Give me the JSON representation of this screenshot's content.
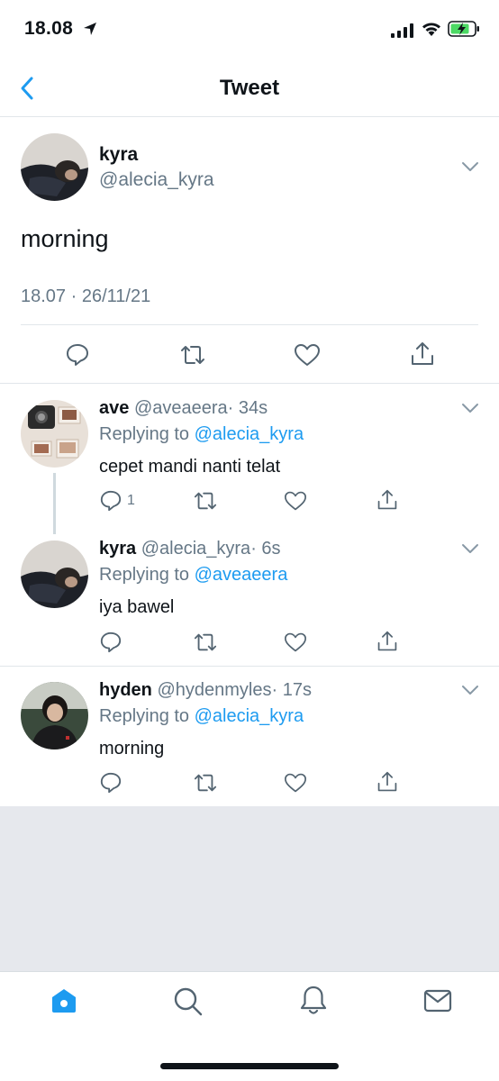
{
  "status_bar": {
    "time": "18.08"
  },
  "nav": {
    "title": "Tweet"
  },
  "main_tweet": {
    "name": "kyra",
    "handle": "@alecia_kyra",
    "text": "morning",
    "timestamp": "18.07 · 26/11/21"
  },
  "replies": [
    {
      "name": "ave",
      "handle": "@aveaeera",
      "time": "· 34s",
      "replying_label": "Replying to",
      "replying_to": "@alecia_kyra",
      "text": "cepet mandi nanti telat",
      "reply_count": "1"
    },
    {
      "name": "kyra",
      "handle": "@alecia_kyra",
      "time": "· 6s",
      "replying_label": "Replying to",
      "replying_to": "@aveaeera",
      "text": "iya bawel"
    },
    {
      "name": "hyden",
      "handle": "@hydenmyles",
      "time": "· 17s",
      "replying_label": "Replying to",
      "replying_to": "@alecia_kyra",
      "text": "morning"
    }
  ],
  "tabs": [
    {
      "icon": "home-icon",
      "active": true
    },
    {
      "icon": "search-icon",
      "active": false
    },
    {
      "icon": "bell-icon",
      "active": false
    },
    {
      "icon": "mail-icon",
      "active": false
    }
  ],
  "colors": {
    "accent": "#1d9bf0",
    "secondary_text": "#657786",
    "battery": "#4cd964"
  }
}
